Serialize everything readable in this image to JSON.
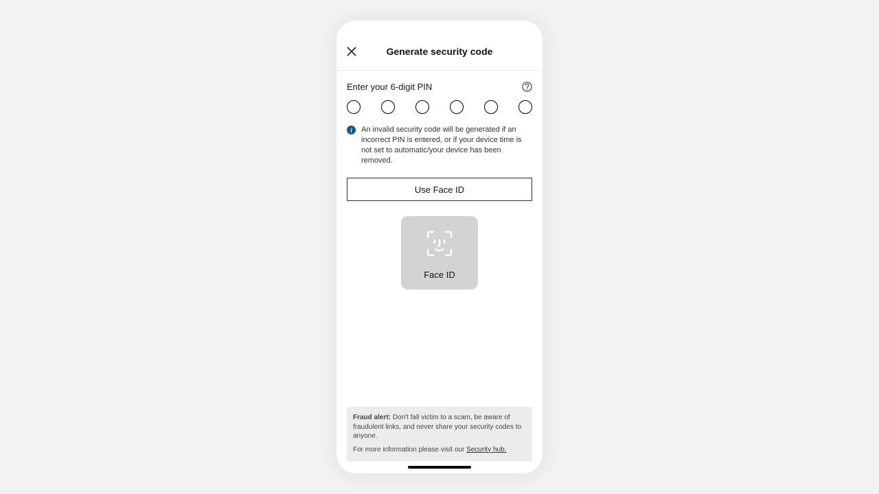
{
  "header": {
    "title": "Generate security code"
  },
  "prompt": "Enter your 6-digit PIN",
  "pin_count": 6,
  "info": "An invalid security code will be generated if an incorrect PIN is entered, or if your device time is not set to automatic/your device has been removed.",
  "face_id_button": "Use Face ID",
  "face_id_card_label": "Face ID",
  "footer": {
    "fraud_label": "Fraud alert:",
    "fraud_text": " Don't fall victim to a scam, be aware of fraudulent links, and never share your security codes to anyone.",
    "more_text": "For more information please visit our ",
    "link_text": "Security hub."
  }
}
